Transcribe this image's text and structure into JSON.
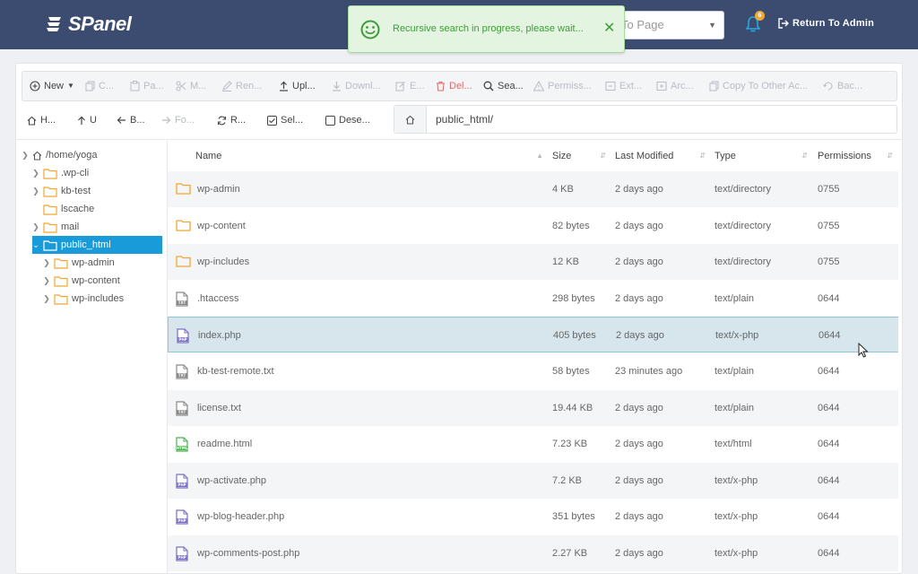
{
  "header": {
    "logo_text": "SPanel",
    "goto_placeholder": "To Page",
    "notification_count": "6",
    "return_label": "Return To Admin",
    "bg_color": "#3b4c70"
  },
  "toast": {
    "message": "Recursive search in progress, please wait...",
    "close_label": "✕",
    "color": "#3f9a3a"
  },
  "toolbar": {
    "new": "New",
    "copy": "C...",
    "paste": "Pa...",
    "move": "M...",
    "rename": "Ren...",
    "upload": "Upl...",
    "download": "Downl...",
    "edit": "E...",
    "delete": "Del...",
    "search": "Sea...",
    "permissions": "Permiss...",
    "extract": "Ext...",
    "archive": "Arc...",
    "copy_other": "Copy To Other Ac...",
    "backup": "Bac..."
  },
  "nav": {
    "home": "H...",
    "up": "U",
    "back": "B...",
    "forward": "Fo...",
    "reload": "R...",
    "select": "Sel...",
    "deselect": "Dese...",
    "path": "public_html/"
  },
  "tree": {
    "root": "/home/yoga",
    "items": [
      {
        "label": ".wp-cli"
      },
      {
        "label": "kb-test"
      },
      {
        "label": "lscache"
      },
      {
        "label": "mail"
      },
      {
        "label": "public_html"
      },
      {
        "label": "wp-admin"
      },
      {
        "label": "wp-content"
      },
      {
        "label": "wp-includes"
      }
    ]
  },
  "table": {
    "columns": [
      "Name",
      "Size",
      "Last Modified",
      "Type",
      "Permissions"
    ],
    "rows": [
      {
        "name": "wp-admin",
        "size": "4 KB",
        "modified": "2 days ago",
        "type": "text/directory",
        "perms": "0755",
        "icon": "folder-icon"
      },
      {
        "name": "wp-content",
        "size": "82 bytes",
        "modified": "2 days ago",
        "type": "text/directory",
        "perms": "0755",
        "icon": "folder-icon"
      },
      {
        "name": "wp-includes",
        "size": "12 KB",
        "modified": "2 days ago",
        "type": "text/directory",
        "perms": "0755",
        "icon": "folder-icon"
      },
      {
        "name": ".htaccess",
        "size": "298 bytes",
        "modified": "2 days ago",
        "type": "text/plain",
        "perms": "0644",
        "icon": "txt-file-icon"
      },
      {
        "name": "index.php",
        "size": "405 bytes",
        "modified": "2 days ago",
        "type": "text/x-php",
        "perms": "0644",
        "icon": "php-file-icon"
      },
      {
        "name": "kb-test-remote.txt",
        "size": "58 bytes",
        "modified": "23 minutes ago",
        "type": "text/plain",
        "perms": "0644",
        "icon": "txt-file-icon"
      },
      {
        "name": "license.txt",
        "size": "19.44 KB",
        "modified": "2 days ago",
        "type": "text/plain",
        "perms": "0644",
        "icon": "txt-file-icon"
      },
      {
        "name": "readme.html",
        "size": "7.23 KB",
        "modified": "2 days ago",
        "type": "text/html",
        "perms": "0644",
        "icon": "html-file-icon"
      },
      {
        "name": "wp-activate.php",
        "size": "7.2 KB",
        "modified": "2 days ago",
        "type": "text/x-php",
        "perms": "0644",
        "icon": "php-file-icon"
      },
      {
        "name": "wp-blog-header.php",
        "size": "351 bytes",
        "modified": "2 days ago",
        "type": "text/x-php",
        "perms": "0644",
        "icon": "php-file-icon"
      },
      {
        "name": "wp-comments-post.php",
        "size": "2.27 KB",
        "modified": "2 days ago",
        "type": "text/x-php",
        "perms": "0644",
        "icon": "php-file-icon"
      }
    ],
    "file_icon_labels": {
      "txt": "TXT",
      "php": "PHP",
      "html": "HTML"
    }
  },
  "colors": {
    "accent": "#1a9bd9",
    "folder": "#f0a830",
    "php": "#7b6fc4",
    "html": "#4caf50",
    "txt": "#888888",
    "selected_row": "#d6e6ec"
  }
}
